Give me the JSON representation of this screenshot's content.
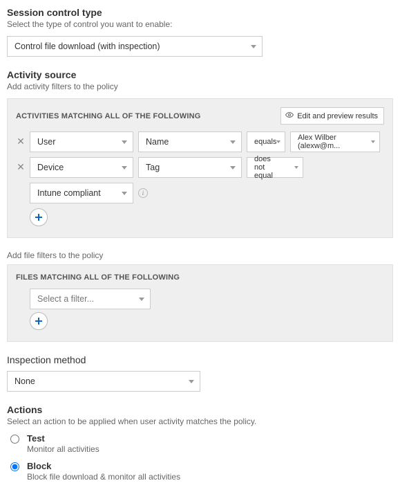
{
  "session_control": {
    "title": "Session control type",
    "subtitle": "Select the type of control you want to enable:",
    "value": "Control file download (with inspection)"
  },
  "activity_source": {
    "title": "Activity source",
    "subtitle": "Add activity filters to the policy",
    "panel_label": "ACTIVITIES MATCHING ALL OF THE FOLLOWING",
    "edit_preview": "Edit and preview results",
    "rows": [
      {
        "field": "User",
        "attr": "Name",
        "op": "equals",
        "value": "Alex Wilber (alexw@m..."
      },
      {
        "field": "Device",
        "attr": "Tag",
        "op": "does not equal",
        "value": ""
      }
    ],
    "extra_value": "Intune compliant"
  },
  "file_filters": {
    "subtitle": "Add file filters to the policy",
    "panel_label": "FILES MATCHING ALL OF THE FOLLOWING",
    "select_placeholder": "Select a filter..."
  },
  "inspection": {
    "title": "Inspection method",
    "value": "None"
  },
  "actions": {
    "title": "Actions",
    "subtitle": "Select an action to be applied when user activity matches the policy.",
    "options": [
      {
        "label": "Test",
        "desc": "Monitor all activities",
        "checked": false
      },
      {
        "label": "Block",
        "desc": "Block file download & monitor all activities",
        "checked": true
      }
    ]
  }
}
